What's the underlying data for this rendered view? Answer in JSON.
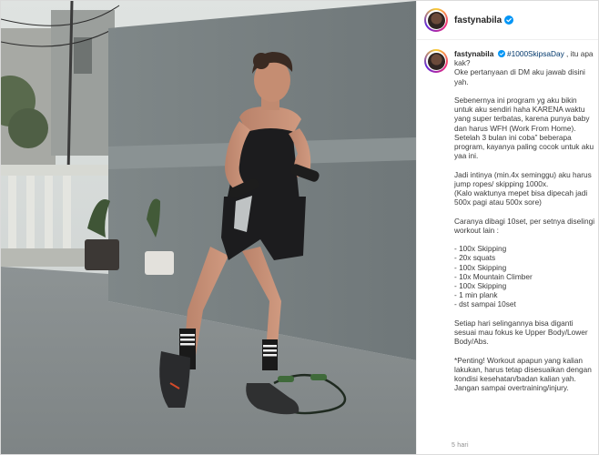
{
  "header": {
    "username": "fastynabila",
    "verified_icon": "verified-badge-icon"
  },
  "caption": {
    "username": "fastynabila",
    "hashtag": "#1000SkipsaDay",
    "text_after_hashtag": " , itu apa kak?\nOke pertanyaan di DM aku jawab disini yah.\n\nSebenernya ini program yg aku bikin untuk aku sendiri haha KARENA waktu yang super terbatas, karena punya baby dan harus WFH (Work From Home). Setelah 3 bulan ini coba” beberapa program, kayanya paling cocok untuk aku yaa ini.\n\nJadi intinya (min.4x seminggu) aku harus jump ropes/ skipping 1000x.\n(Kalo waktunya mepet bisa dipecah jadi 500x pagi atau 500x sore)\n\nCaranya dibagi 10set, per setnya diselingi workout lain :\n\n- 100x Skipping\n- 20x squats\n- 100x Skipping\n- 10x Mountain Climber\n- 100x Skipping\n- 1 min plank\n- dst sampai 10set\n\nSetiap hari selingannya bisa diganti sesuai mau fokus ke Upper Body/Lower Body/Abs.\n\n*Penting! Workout apapun yang kalian lakukan, harus tetap disesuaikan dengan kondisi kesehatan/badan kalian yah. Jangan sampai overtraining/injury."
  },
  "timestamp": "5 hari",
  "colors": {
    "accent": "#0095f6",
    "hashtag": "#00376b",
    "text": "#262626",
    "muted": "#8e8e8e"
  }
}
